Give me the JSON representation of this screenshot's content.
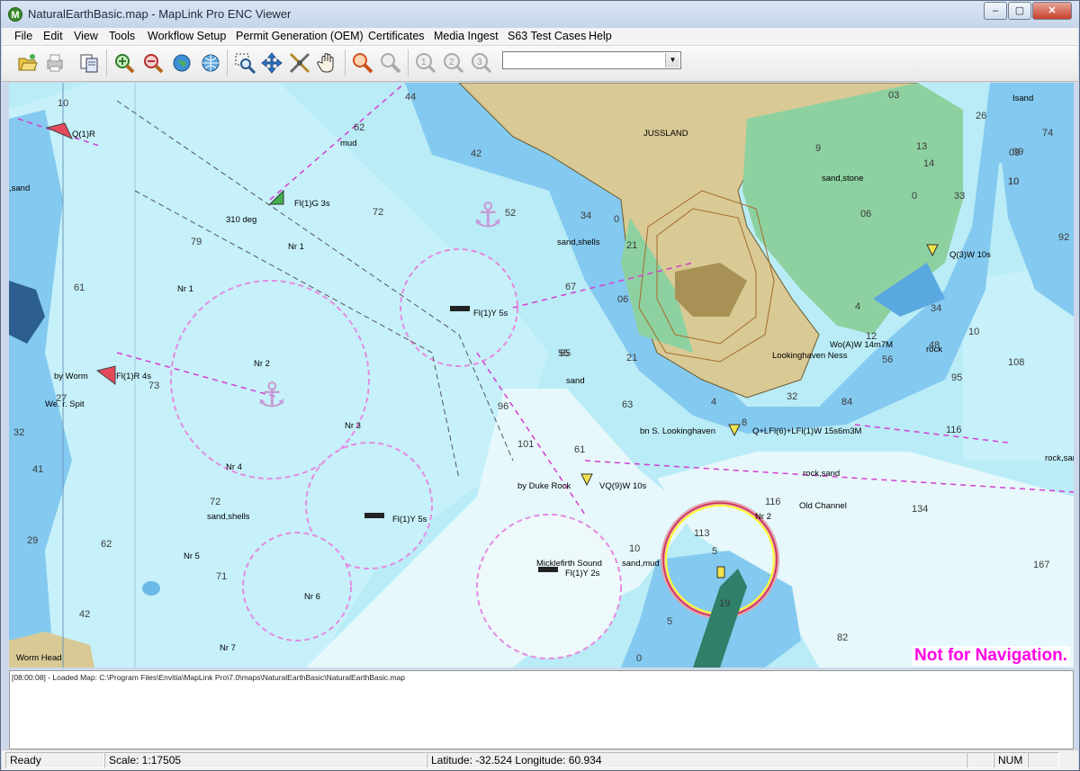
{
  "window": {
    "title": "NaturalEarthBasic.map - MapLink Pro ENC Viewer",
    "app_icon_letter": "M",
    "minimize_glyph": "‒",
    "maximize_glyph": "▢",
    "close_glyph": "✕"
  },
  "menu": [
    "File",
    "Edit",
    "View",
    "Tools",
    "Workflow Setup",
    "Permit Generation (OEM)",
    "Certificates",
    "Media Ingest",
    "S63 Test Cases",
    "Help"
  ],
  "toolbar": {
    "buttons": [
      "open-icon",
      "print-icon",
      "copy-icon",
      "zoom-in-icon",
      "zoom-out-icon",
      "globe-icon",
      "globe-grid-icon",
      "zoom-window-icon",
      "pan-icon",
      "measure-icon",
      "hand-icon",
      "query-icon",
      "query-disabled-icon",
      "layer-1-icon",
      "layer-2-icon",
      "layer-3-icon"
    ],
    "combo_value": ""
  },
  "map": {
    "not_for_navigation": "Not for Navigation.",
    "labels": [
      "Q(1)R",
      "mud",
      ",sand",
      "Fl(1)G 3s",
      "310 deg",
      "Nr 1",
      "Nr 1",
      "Fl(1)Y 5s",
      "sand,shells",
      "by Worm",
      "Fl(1)R 4s",
      "We. r. Spit",
      "Nr 2",
      "Nr 3",
      "Nr 4",
      "Fl(1)Y 5s",
      "sand,shells",
      "Nr 5",
      "Nr 6",
      "Nr 7",
      "Worm Head",
      "sand",
      "by Duke Rock",
      "VQ(9)W 10s",
      "Micklefirth Sound",
      "Fl(1)Y 2s",
      "sand,mud",
      "JUSSLAND",
      "sand,stone",
      "Q(3)W 10s",
      "Wo(A)W 14m7M",
      "Lookinghaven Ness",
      "rock",
      "bn S. Lookinghaven",
      "Q+LFl(6)+LFl(1)W 15s6m3M",
      "rock,sand",
      "Old Channel",
      "Nr 2",
      "rock,sand",
      "Isand"
    ],
    "soundings": [
      "10",
      "62",
      "44",
      "42",
      "52",
      "72",
      "79",
      "61",
      "67",
      "65",
      "73",
      "96",
      "55",
      "101",
      "61",
      "63",
      "72",
      "62",
      "71",
      "42",
      "32",
      "29",
      "41",
      "27",
      "34",
      "21",
      "06",
      "0",
      "21",
      "4",
      "8",
      "32",
      "84",
      "56",
      "48",
      "10",
      "108",
      "95",
      "116",
      "113",
      "116",
      "134",
      "167",
      "82",
      "10",
      "5",
      "5",
      "19",
      "0",
      "03",
      "13",
      "09",
      "14",
      "33",
      "06",
      "0",
      "26",
      "92",
      "10",
      "34",
      "4",
      "12",
      "9",
      "09",
      "10",
      "74"
    ]
  },
  "log": {
    "line": "[08:00:08] - Loaded Map: C:\\Program Files\\Envitia\\MapLink Pro\\7.0\\maps\\NaturalEarthBasic\\NaturalEarthBasic.map"
  },
  "status": {
    "ready": "Ready",
    "scale": "Scale: 1:17505",
    "coords": "Latitude: -32.524  Longitude: 60.934",
    "num": "NUM"
  },
  "colors": {
    "deep_water": "#e6f8fb",
    "mid_water": "#b9ecf7",
    "shallow_water": "#84c9ef",
    "land": "#d8c995",
    "green_intertidal": "#8ed1a1",
    "magenta": "#d63cd0"
  }
}
